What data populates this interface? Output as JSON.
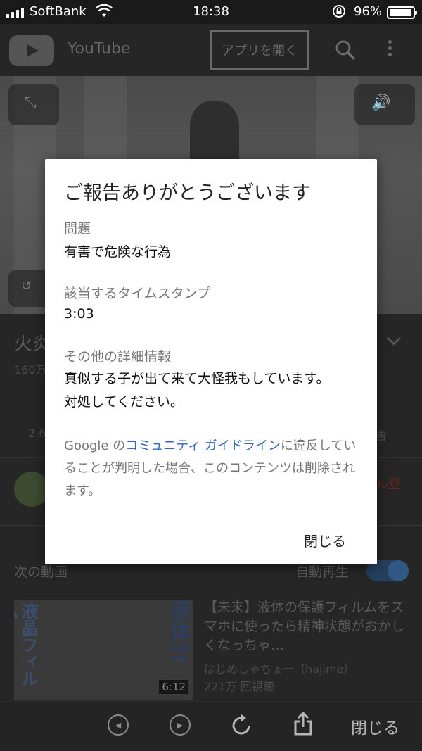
{
  "status_bar": {
    "carrier": "SoftBank",
    "time": "18:38",
    "battery_percent": "96%",
    "battery_level": 0.96
  },
  "youtube_header": {
    "app_name": "YouTube",
    "open_app_label": "アプリを開く"
  },
  "video_info": {
    "title_fragment": "火炎",
    "views_fragment": "160万",
    "like_count_fragment": "2.6",
    "report_fragment": "告",
    "subscribe_fragment": "ル登"
  },
  "up_next": {
    "label": "次の動画",
    "autoplay_label": "自動再生",
    "autoplay_on": true,
    "item": {
      "title": "【未来】液体の保護フィルムをスマホに使ったら精神状態がおかしくなっちゃ…",
      "channel": "はじめしゃちょー（hajime）",
      "views": "221万 回視聴",
      "duration": "6:12",
      "thumb_text_left": "液晶フィルム",
      "thumb_text_right": "液体?!"
    }
  },
  "dialog": {
    "title": "ご報告ありがとうございます",
    "issue_label": "問題",
    "issue_value": "有害で危険な行為",
    "timestamp_label": "該当するタイムスタンプ",
    "timestamp_value": "3:03",
    "details_label": "その他の詳細情報",
    "details_value": "真似する子が出て来て大怪我もしています。\n対処してください。",
    "note_prefix": "Google の",
    "note_link": "コミュニティ ガイドライン",
    "note_suffix": "に違反していることが判明した場合、このコンテンツは削除されます。",
    "close_label": "閉じる"
  },
  "toolbar": {
    "close_label": "閉じる"
  },
  "colors": {
    "link": "#3266c2",
    "subscribe_red": "#cc0000",
    "toggle_blue": "#3b82c4"
  }
}
